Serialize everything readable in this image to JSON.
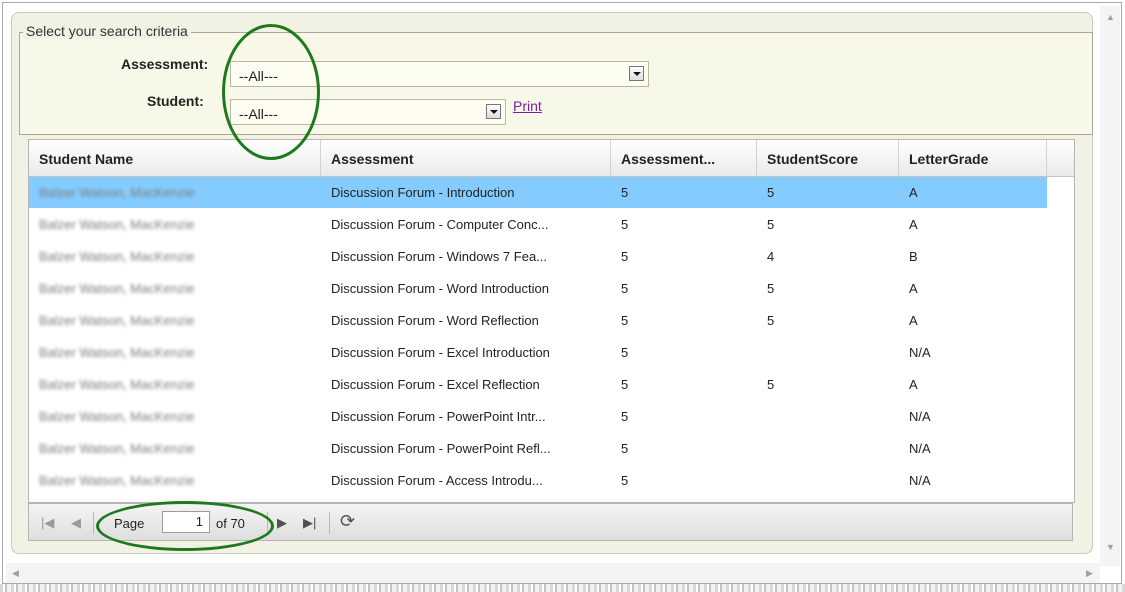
{
  "criteria": {
    "legend": "Select your search criteria",
    "assessment_label": "Assessment:",
    "assessment_value": "--All---",
    "student_label": "Student:",
    "student_value": "--All---",
    "print_label": "Print"
  },
  "grid": {
    "columns": [
      "Student Name",
      "Assessment",
      "Assessment...",
      "StudentScore",
      "LetterGrade"
    ],
    "rows": [
      {
        "student": "Balzer Watson, MacKenzie",
        "assessment": "Discussion Forum - Introduction",
        "points": "5",
        "score": "5",
        "grade": "A"
      },
      {
        "student": "Balzer Watson, MacKenzie",
        "assessment": "Discussion Forum - Computer Conc...",
        "points": "5",
        "score": "5",
        "grade": "A"
      },
      {
        "student": "Balzer Watson, MacKenzie",
        "assessment": "Discussion Forum - Windows 7 Fea...",
        "points": "5",
        "score": "4",
        "grade": "B"
      },
      {
        "student": "Balzer Watson, MacKenzie",
        "assessment": "Discussion Forum - Word Introduction",
        "points": "5",
        "score": "5",
        "grade": "A"
      },
      {
        "student": "Balzer Watson, MacKenzie",
        "assessment": "Discussion Forum - Word Reflection",
        "points": "5",
        "score": "5",
        "grade": "A"
      },
      {
        "student": "Balzer Watson, MacKenzie",
        "assessment": "Discussion Forum - Excel Introduction",
        "points": "5",
        "score": "",
        "grade": "N/A"
      },
      {
        "student": "Balzer Watson, MacKenzie",
        "assessment": "Discussion Forum - Excel Reflection",
        "points": "5",
        "score": "5",
        "grade": "A"
      },
      {
        "student": "Balzer Watson, MacKenzie",
        "assessment": "Discussion Forum - PowerPoint Intr...",
        "points": "5",
        "score": "",
        "grade": "N/A"
      },
      {
        "student": "Balzer Watson, MacKenzie",
        "assessment": "Discussion Forum - PowerPoint Refl...",
        "points": "5",
        "score": "",
        "grade": "N/A"
      },
      {
        "student": "Balzer Watson, MacKenzie",
        "assessment": "Discussion Forum - Access Introdu...",
        "points": "5",
        "score": "",
        "grade": "N/A"
      }
    ],
    "selected_row": 0
  },
  "pager": {
    "page_label": "Page",
    "page_value": "1",
    "of_label": "of 70"
  },
  "colors": {
    "selected_row": "#84ccff",
    "highlight_ring": "#1c7a1c",
    "print_link": "#7a1ea1"
  }
}
